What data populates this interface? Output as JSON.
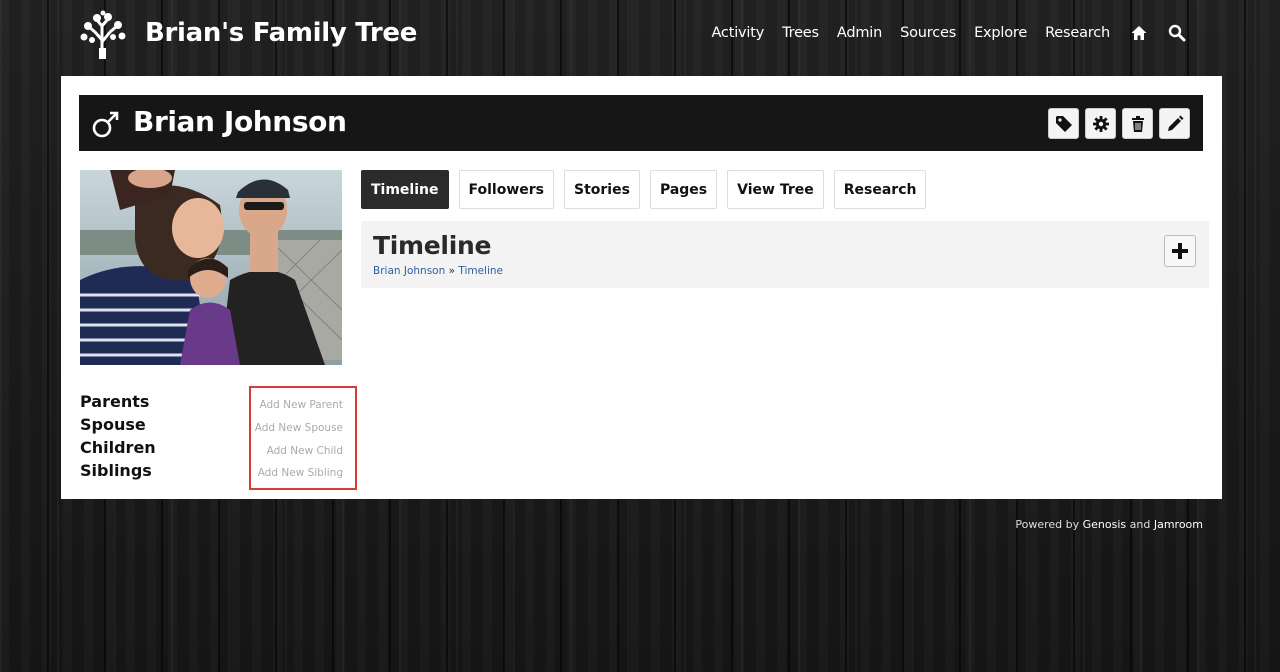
{
  "site": {
    "title": "Brian's Family Tree",
    "nav": [
      "Activity",
      "Trees",
      "Admin",
      "Sources",
      "Explore",
      "Research"
    ],
    "icons": {
      "home": "home-icon",
      "search": "search-icon",
      "logo": "tree-logo-icon"
    }
  },
  "profile": {
    "name": "Brian Johnson",
    "gender_icon": "male-symbol-icon",
    "actions": [
      "tag-icon",
      "gear-icon",
      "trash-icon",
      "pencil-icon"
    ]
  },
  "tabs": [
    {
      "label": "Timeline",
      "active": true
    },
    {
      "label": "Followers",
      "active": false
    },
    {
      "label": "Stories",
      "active": false
    },
    {
      "label": "Pages",
      "active": false
    },
    {
      "label": "View Tree",
      "active": false
    },
    {
      "label": "Research",
      "active": false
    }
  ],
  "timeline": {
    "title": "Timeline",
    "breadcrumb": {
      "person": "Brian Johnson",
      "separator": " » ",
      "page": "Timeline"
    },
    "add_icon": "plus-icon"
  },
  "relations": {
    "labels": [
      "Parents",
      "Spouse",
      "Children",
      "Siblings"
    ],
    "links": [
      "Add New Parent",
      "Add New Spouse",
      "Add New Child",
      "Add New Sibling"
    ]
  },
  "footer": {
    "prefix": "Powered by ",
    "link1": "Genosis",
    "middle": " and ",
    "link2": "Jamroom"
  },
  "colors": {
    "accent_dark": "#161616",
    "link_blue": "#2f5fa0",
    "highlight_red": "#d93a35"
  }
}
